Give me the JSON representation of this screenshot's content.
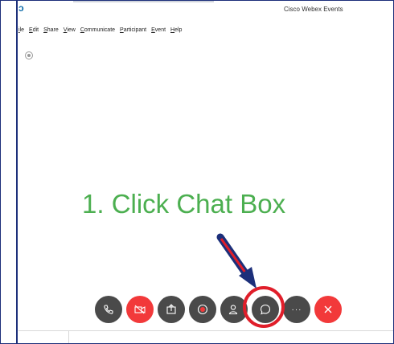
{
  "window": {
    "title": "Cisco Webex Events"
  },
  "menu": [
    "ile",
    "Edit",
    "Share",
    "View",
    "Communicate",
    "Participant",
    "Event",
    "Help"
  ],
  "annotation": {
    "text": "1. Click Chat Box",
    "text_color": "#4caf50",
    "arrow_color": "#1c2f7a",
    "arrow_inner_color": "#e01e2a",
    "ring_color": "#e01e2a"
  },
  "controls": [
    {
      "name": "audio-button",
      "icon": "phone-icon",
      "style": "dark"
    },
    {
      "name": "video-button",
      "icon": "video-off-icon",
      "style": "red"
    },
    {
      "name": "share-button",
      "icon": "share-icon",
      "style": "dark"
    },
    {
      "name": "record-button",
      "icon": "record-icon",
      "style": "dark"
    },
    {
      "name": "participants-button",
      "icon": "participants-icon",
      "style": "dark"
    },
    {
      "name": "chat-button",
      "icon": "chat-icon",
      "style": "dark"
    },
    {
      "name": "more-button",
      "icon": "more-icon",
      "style": "dark"
    },
    {
      "name": "leave-button",
      "icon": "close-icon",
      "style": "red"
    }
  ]
}
